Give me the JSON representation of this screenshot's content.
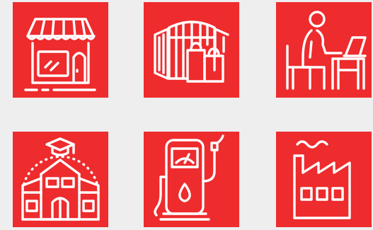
{
  "colors": {
    "background": "#EEEEEF",
    "tile": "#EE2B2D",
    "icon_stroke": "#FFFFFF"
  },
  "tiles": [
    {
      "icon": "storefront-icon"
    },
    {
      "icon": "shopping-mall-icon"
    },
    {
      "icon": "office-worker-icon"
    },
    {
      "icon": "university-icon"
    },
    {
      "icon": "fuel-pump-icon"
    },
    {
      "icon": "factory-icon"
    }
  ]
}
